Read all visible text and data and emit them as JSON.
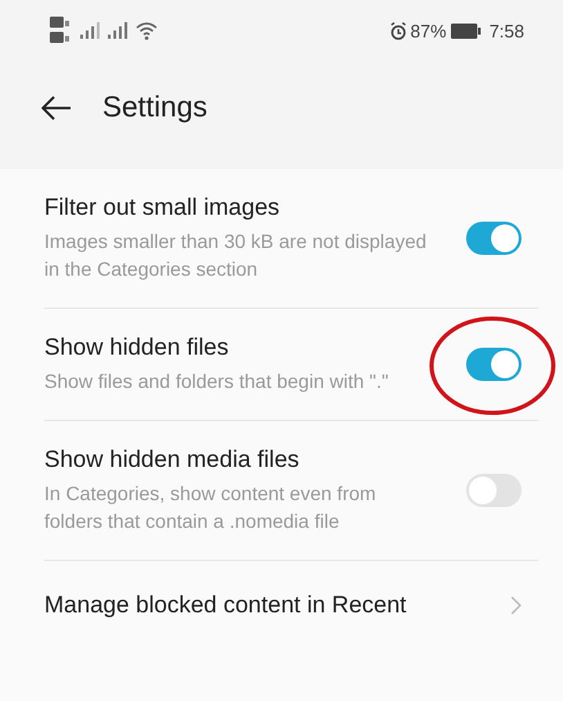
{
  "status_bar": {
    "battery_text": "87%",
    "time": "7:58"
  },
  "header": {
    "title": "Settings"
  },
  "items": [
    {
      "kind": "toggle",
      "title": "Filter out small images",
      "subtitle": "Images smaller than 30 kB are not displayed in the Categories section",
      "on": true,
      "circled": false
    },
    {
      "kind": "toggle",
      "title": "Show hidden files",
      "subtitle": "Show files and folders that begin with \".\"",
      "on": true,
      "circled": true
    },
    {
      "kind": "toggle",
      "title": "Show hidden media files",
      "subtitle": "In Categories, show content even from folders that contain a .nomedia file",
      "on": false,
      "circled": false
    },
    {
      "kind": "link",
      "title": "Manage blocked content in Recent"
    }
  ]
}
